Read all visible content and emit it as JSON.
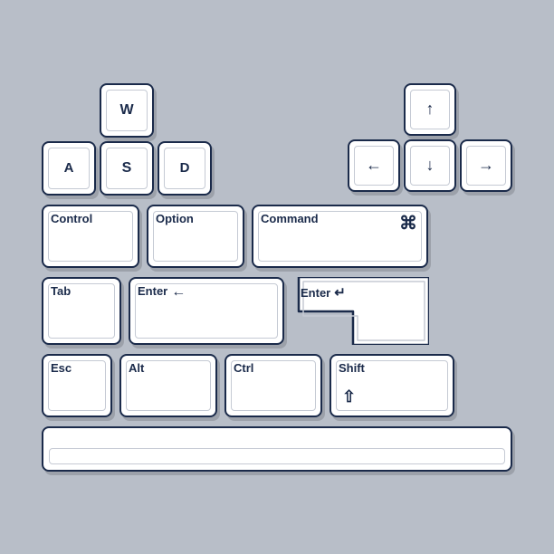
{
  "keys": {
    "w": "W",
    "a": "A",
    "s": "S",
    "d": "D",
    "arrow_up": "↑",
    "arrow_left": "←",
    "arrow_down": "↓",
    "arrow_right": "→",
    "control": "Control",
    "option": "Option",
    "command": "Command",
    "command_symbol": "⌘",
    "tab": "Tab",
    "enter_small": "Enter",
    "enter_arrow": "←",
    "enter_big": "Enter",
    "enter_big_arrow": "↵",
    "esc": "Esc",
    "alt": "Alt",
    "ctrl": "Ctrl",
    "shift": "Shift",
    "shift_symbol": "⇧",
    "spacebar": ""
  },
  "colors": {
    "bg": "#b8bec8",
    "key_bg": "#ffffff",
    "key_border": "#1a2a4a",
    "key_shadow": "rgba(0,0,0,0.18)",
    "inner_border": "#c5cad4",
    "text": "#1a2a4a"
  }
}
